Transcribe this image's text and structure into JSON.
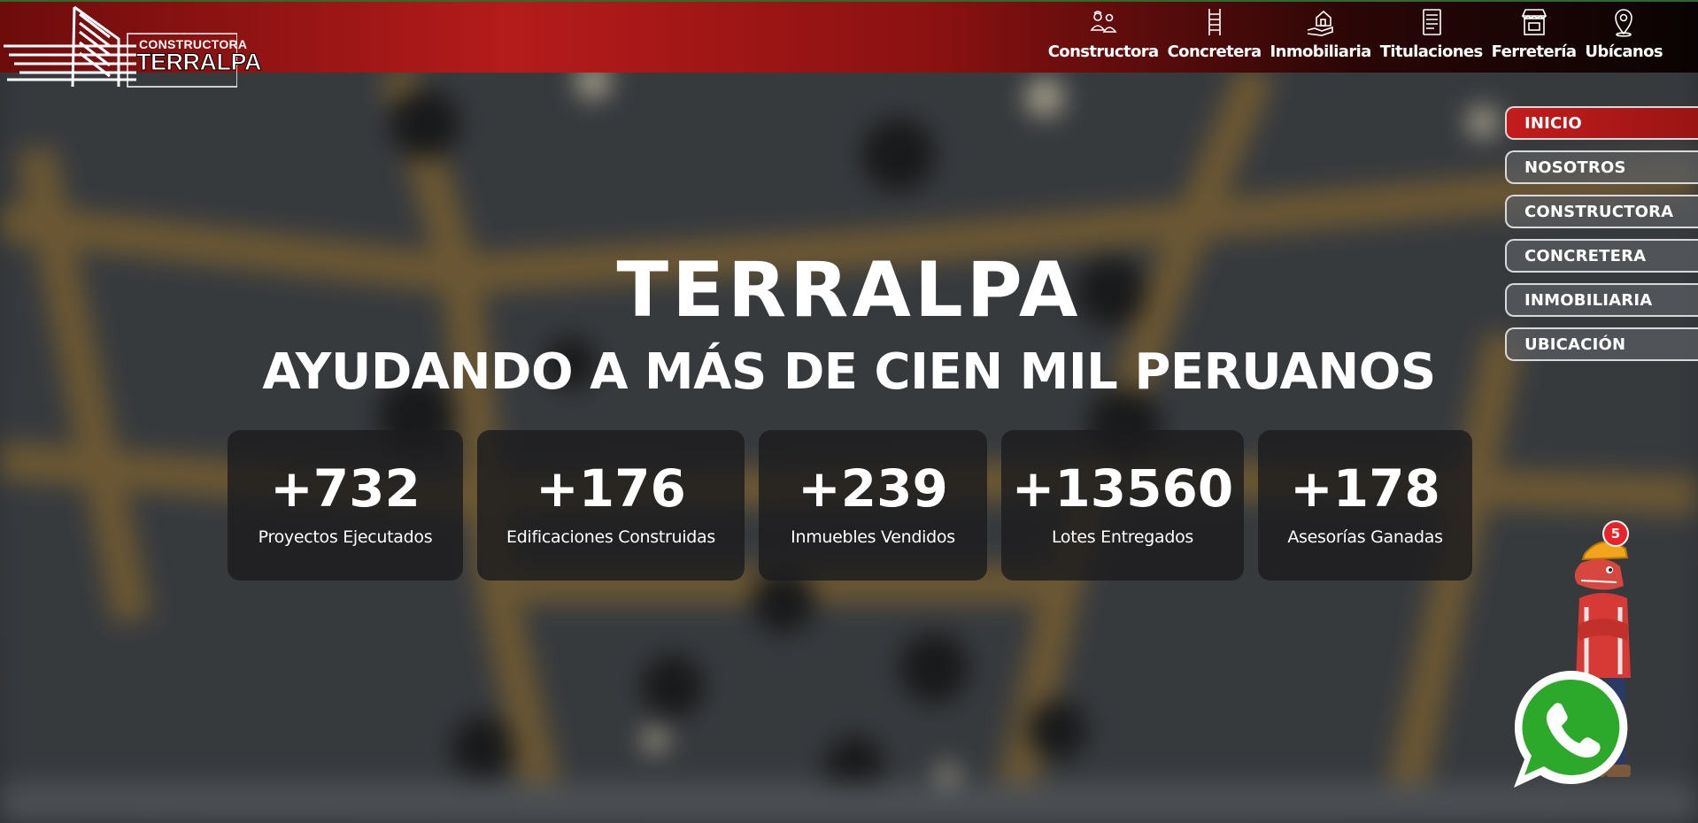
{
  "brand": {
    "sub": "CONSTRUCTORA",
    "name": "TERRALPA"
  },
  "topnav": [
    {
      "label": "Constructora",
      "icon": "worker-team-icon"
    },
    {
      "label": "Concretera",
      "icon": "ladder-icon"
    },
    {
      "label": "Inmobiliaria",
      "icon": "house-hand-icon"
    },
    {
      "label": "Titulaciones",
      "icon": "document-icon"
    },
    {
      "label": "Ferretería",
      "icon": "store-icon"
    },
    {
      "label": "Ubícanos",
      "icon": "location-pin-icon"
    }
  ],
  "sidenav": [
    {
      "label": "INICIO",
      "active": true
    },
    {
      "label": "NOSOTROS"
    },
    {
      "label": "CONSTRUCTORA"
    },
    {
      "label": "CONCRETERA"
    },
    {
      "label": "INMOBILIARIA"
    },
    {
      "label": "UBICACIÓN"
    }
  ],
  "hero": {
    "title": "TERRALPA",
    "subtitle": "AYUDANDO A MÁS DE CIEN MIL PERUANOS"
  },
  "stats": [
    {
      "value": "+732",
      "label": "Proyectos Ejecutados"
    },
    {
      "value": "+176",
      "label": "Edificaciones Construidas"
    },
    {
      "value": "+239",
      "label": "Inmuebles Vendidos"
    },
    {
      "value": "+13560",
      "label": "Lotes Entregados"
    },
    {
      "value": "+178",
      "label": "Asesorías Ganadas"
    }
  ],
  "chat": {
    "badge": "5"
  },
  "colors": {
    "brand_red": "#b51b1b",
    "whatsapp_green": "#2ca82a"
  }
}
